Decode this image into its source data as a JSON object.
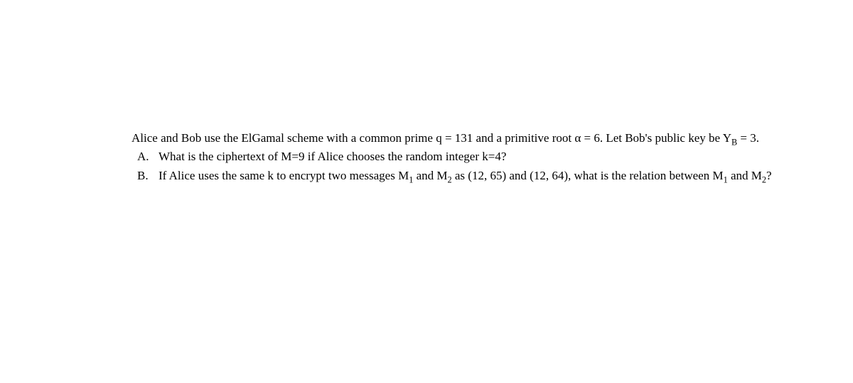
{
  "intro": {
    "part1": "Alice and Bob use the ElGamal scheme with a common prime q = 131 and a primitive root α = 6. Let Bob's public key be Y",
    "sub1": "B",
    "part2": " = 3."
  },
  "items": [
    {
      "marker": "A.",
      "content": [
        {
          "text": "What is the ciphertext of M=9 if Alice chooses the random integer k=4?"
        }
      ]
    },
    {
      "marker": "B.",
      "content": [
        {
          "text": "If Alice uses the same k to encrypt two messages M"
        },
        {
          "sub": "1"
        },
        {
          "text": " and M"
        },
        {
          "sub": "2"
        },
        {
          "text": " as (12, 65) and (12, 64), what is the relation between M"
        },
        {
          "sub": "1"
        },
        {
          "text": " and M"
        },
        {
          "sub": "2"
        },
        {
          "text": "?"
        }
      ]
    }
  ]
}
